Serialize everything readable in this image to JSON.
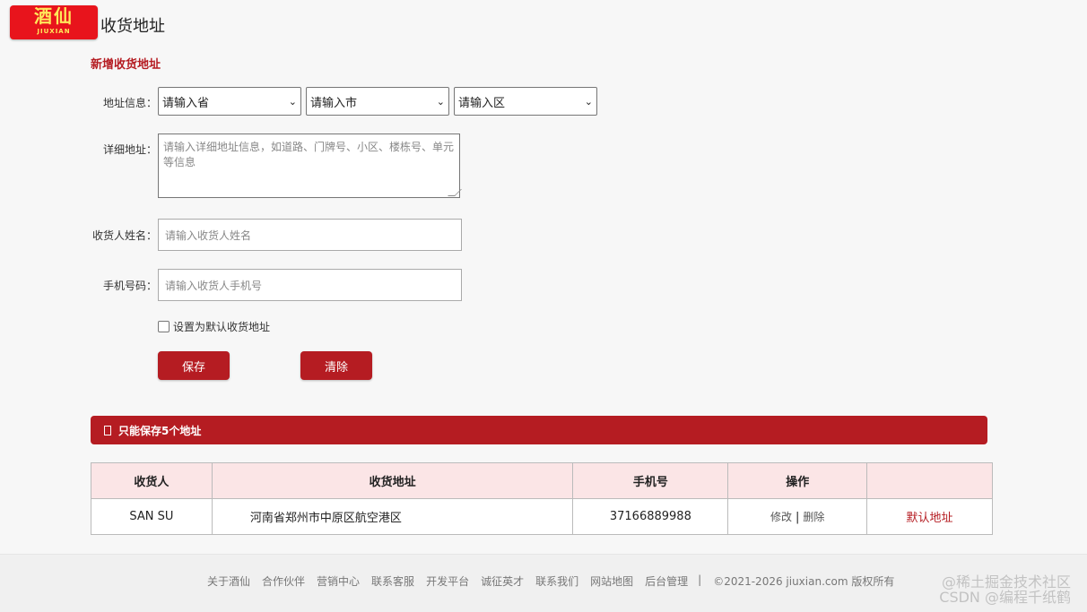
{
  "header": {
    "logo_cn": "酒仙",
    "logo_en": "JIUXIAN",
    "title": "收货地址"
  },
  "form": {
    "section_title": "新增收货地址",
    "address_label": "地址信息：",
    "province_value": "请输入省",
    "city_value": "请输入市",
    "district_value": "请输入区",
    "detail_label": "详细地址：",
    "detail_placeholder": "请输入详细地址信息，如道路、门牌号、小区、楼栋号、单元等信息",
    "name_label": "收货人姓名：",
    "name_placeholder": "请输入收货人姓名",
    "phone_label": "手机号码：",
    "phone_placeholder": "请输入收货人手机号",
    "default_checkbox_label": "设置为默认收货地址",
    "default_checked": false,
    "save_label": "保存",
    "clear_label": "清除"
  },
  "notice": {
    "text": "只能保存5个地址"
  },
  "table": {
    "headers": [
      "收货人",
      "收货地址",
      "手机号",
      "操作",
      ""
    ],
    "rows": [
      {
        "name": "SAN SU",
        "address": "河南省郑州市中原区航空港区",
        "phone": "37166889988",
        "edit": "修改",
        "sep": "|",
        "delete": "删除",
        "default": "默认地址"
      }
    ]
  },
  "footer": {
    "links": [
      "关于酒仙",
      "合作伙伴",
      "营销中心",
      "联系客服",
      "开发平台",
      "诚征英才",
      "联系我们",
      "网站地图",
      "后台管理"
    ],
    "separator": "|",
    "copyright": "©2021-2026 jiuxian.com 版权所有",
    "watermark_line1": "@稀土掘金技术社区",
    "watermark_line2": "CSDN @编程千纸鹤"
  },
  "colors": {
    "brand_red": "#b51c22",
    "logo_red": "#e8141c",
    "header_pink": "#fbe5e6"
  }
}
